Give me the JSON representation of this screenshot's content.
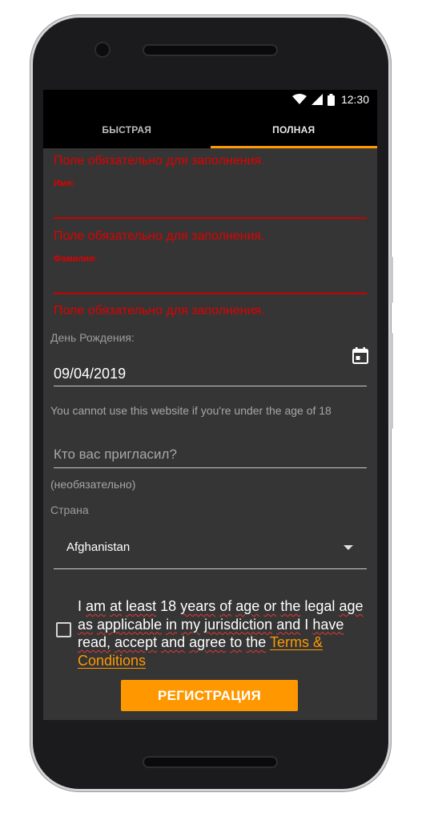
{
  "status_bar": {
    "time": "12:30"
  },
  "tabs": [
    {
      "label": "БЫСТРАЯ",
      "active": false
    },
    {
      "label": "ПОЛНАЯ",
      "active": true
    }
  ],
  "form": {
    "first_name": {
      "error": "Поле обязательно для заполнения.",
      "label": "Имя:",
      "value": ""
    },
    "last_name": {
      "error": "Поле обязательно для заполнения.",
      "label": "Фамилия:",
      "value": ""
    },
    "birthday": {
      "error": "Поле обязательно для заполнения.",
      "label": "День Рождения:",
      "value": "09/04/2019",
      "helper": "You cannot use this website if you're under the age of 18"
    },
    "referrer": {
      "placeholder": "Кто вас пригласил?",
      "helper": "(необязательно)"
    },
    "country": {
      "label": "Страна",
      "selected": "Afghanistan"
    },
    "agreement": {
      "words": [
        "I",
        "am",
        "at",
        "least",
        "18",
        "years",
        "of",
        "age",
        "or",
        "the",
        "legal",
        "age",
        "as",
        "applicable",
        "in",
        "my",
        "jurisdiction",
        "and",
        "I",
        "have",
        "read,",
        "accept",
        "and",
        "agree",
        "to",
        "the"
      ],
      "link_text": "Terms & Conditions",
      "checked": false
    },
    "submit_label": "РЕГИСТРАЦИЯ"
  },
  "colors": {
    "accent": "#ff9800",
    "error": "#e00000",
    "background": "#353535"
  }
}
